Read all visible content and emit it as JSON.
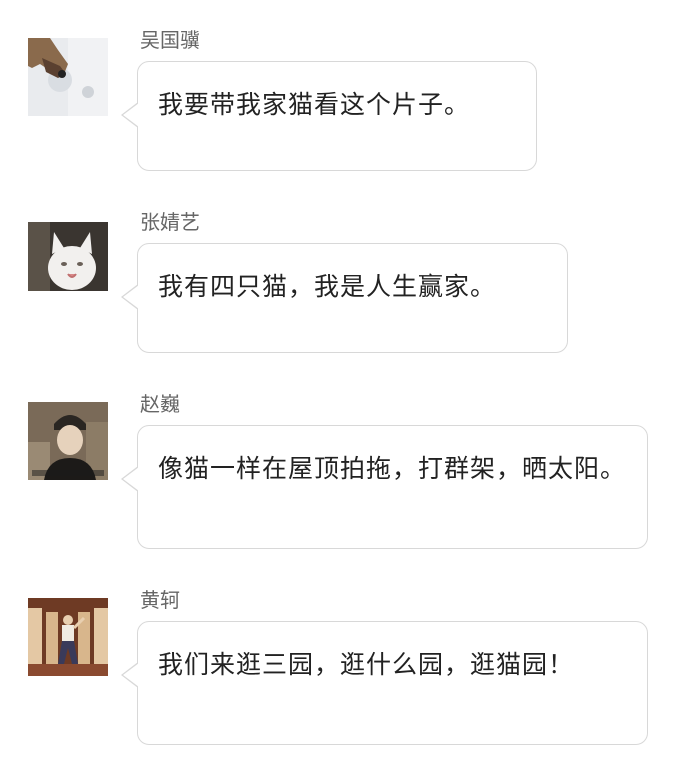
{
  "messages": [
    {
      "sender": "吴国骥",
      "text": "我要带我家猫看这个片子。",
      "avatar_icon": "hand-holding-ball-avatar"
    },
    {
      "sender": "张婧艺",
      "text": "我有四只猫，我是人生赢家。",
      "avatar_icon": "white-cat-avatar"
    },
    {
      "sender": "赵巍",
      "text": "像猫一样在屋顶拍拖，打群架，晒太阳。",
      "avatar_icon": "man-in-cap-avatar"
    },
    {
      "sender": "黄轲",
      "text": "我们来逛三园，逛什么园，逛猫园！",
      "avatar_icon": "stage-performer-avatar"
    }
  ],
  "colors": {
    "bubble_border": "#d8d8d8",
    "sender_text": "#666666",
    "message_text": "#222222"
  }
}
